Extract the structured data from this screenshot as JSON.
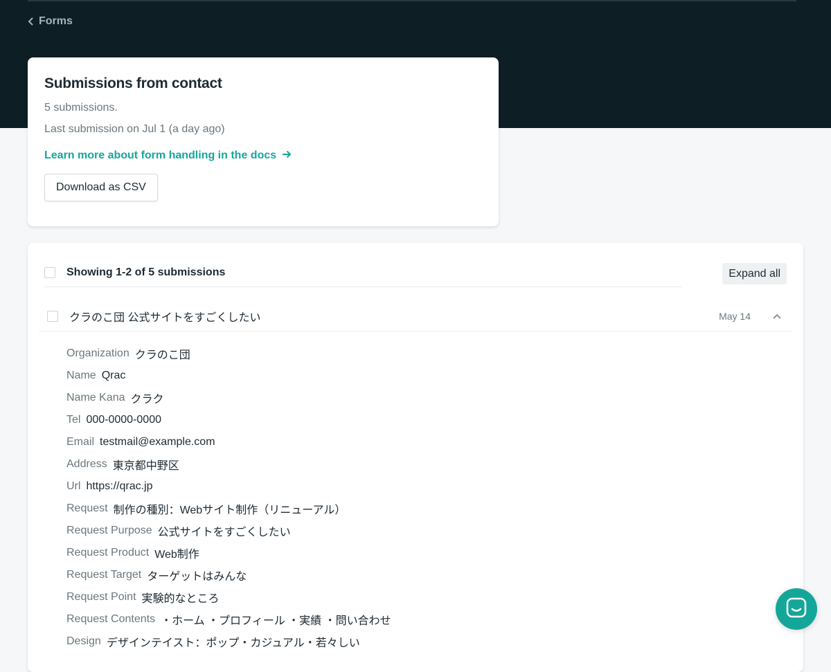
{
  "nav": {
    "back_label": "Forms"
  },
  "summary": {
    "title": "Submissions from contact",
    "count_text": "5 submissions.",
    "last_submission": "Last submission on Jul 1 (a day ago)",
    "docs_link": "Learn more about form handling in the docs",
    "download_label": "Download as CSV"
  },
  "list": {
    "showing_text": "Showing 1-2 of 5 submissions",
    "expand_label": "Expand all"
  },
  "submission": {
    "title": "クラのこ団 公式サイトをすごくしたい",
    "date": "May 14",
    "fields": [
      {
        "key": "Organization",
        "value": "クラのこ団"
      },
      {
        "key": "Name",
        "value": "Qrac"
      },
      {
        "key": "Name Kana",
        "value": "クラク"
      },
      {
        "key": "Tel",
        "value": "000-0000-0000"
      },
      {
        "key": "Email",
        "value": "testmail@example.com"
      },
      {
        "key": "Address",
        "value": "東京都中野区"
      },
      {
        "key": "Url",
        "value": "https://qrac.jp"
      },
      {
        "key": "Request",
        "value": "制作の種別：Webサイト制作（リニューアル）"
      },
      {
        "key": "Request Purpose",
        "value": "公式サイトをすごくしたい"
      },
      {
        "key": "Request Product",
        "value": "Web制作"
      },
      {
        "key": "Request Target",
        "value": "ターゲットはみんな"
      },
      {
        "key": "Request Point",
        "value": "実験的なところ"
      },
      {
        "key": "Request Contents",
        "value": "・ホーム ・プロフィール ・実績 ・問い合わせ"
      },
      {
        "key": "Design",
        "value": "デザインテイスト：ポップ・カジュアル・若々しい"
      }
    ]
  },
  "colors": {
    "hero_bg": "#0e1e25",
    "accent": "#15a69a",
    "page_bg": "#f5f7f8"
  },
  "icons": {
    "back": "chevron-left-icon",
    "docs_arrow": "arrow-right-icon",
    "collapse": "chevron-up-icon",
    "chat": "chat-icon"
  }
}
